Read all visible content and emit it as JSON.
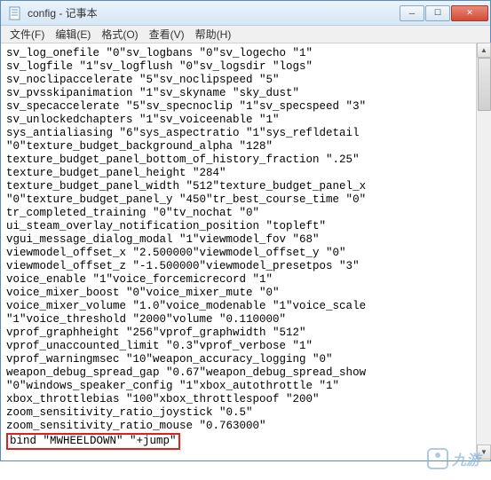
{
  "window": {
    "title": "config - 记事本"
  },
  "menu": {
    "file": "文件(F)",
    "edit": "编辑(E)",
    "format": "格式(O)",
    "view": "查看(V)",
    "help": "帮助(H)"
  },
  "content": {
    "body": "sv_log_onefile \"0\"sv_logbans \"0\"sv_logecho \"1\"\nsv_logfile \"1\"sv_logflush \"0\"sv_logsdir \"logs\"\nsv_noclipaccelerate \"5\"sv_noclipspeed \"5\"\nsv_pvsskipanimation \"1\"sv_skyname \"sky_dust\"\nsv_specaccelerate \"5\"sv_specnoclip \"1\"sv_specspeed \"3\"\nsv_unlockedchapters \"1\"sv_voiceenable \"1\"\nsys_antialiasing \"6\"sys_aspectratio \"1\"sys_refldetail\n\"0\"texture_budget_background_alpha \"128\"\ntexture_budget_panel_bottom_of_history_fraction \".25\"\ntexture_budget_panel_height \"284\"\ntexture_budget_panel_width \"512\"texture_budget_panel_x\n\"0\"texture_budget_panel_y \"450\"tr_best_course_time \"0\"\ntr_completed_training \"0\"tv_nochat \"0\"\nui_steam_overlay_notification_position \"topleft\"\nvgui_message_dialog_modal \"1\"viewmodel_fov \"68\"\nviewmodel_offset_x \"2.500000\"viewmodel_offset_y \"0\"\nviewmodel_offset_z \"-1.500000\"viewmodel_presetpos \"3\"\nvoice_enable \"1\"voice_forcemicrecord \"1\"\nvoice_mixer_boost \"0\"voice_mixer_mute \"0\"\nvoice_mixer_volume \"1.0\"voice_modenable \"1\"voice_scale\n\"1\"voice_threshold \"2000\"volume \"0.110000\"\nvprof_graphheight \"256\"vprof_graphwidth \"512\"\nvprof_unaccounted_limit \"0.3\"vprof_verbose \"1\"\nvprof_warningmsec \"10\"weapon_accuracy_logging \"0\"\nweapon_debug_spread_gap \"0.67\"weapon_debug_spread_show\n\"0\"windows_speaker_config \"1\"xbox_autothrottle \"1\"\nxbox_throttlebias \"100\"xbox_throttlespoof \"200\"\nzoom_sensitivity_ratio_joystick \"0.5\"\nzoom_sensitivity_ratio_mouse \"0.763000\"",
    "highlighted": "bind \"MWHEELDOWN\" \"+jump\""
  },
  "watermark": {
    "text": "九游"
  }
}
